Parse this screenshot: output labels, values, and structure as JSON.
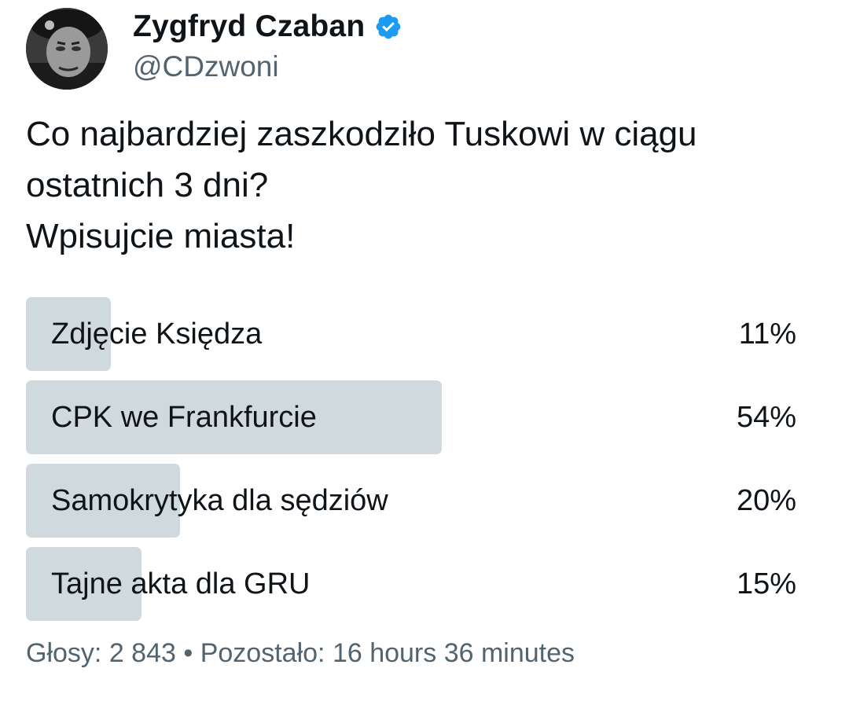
{
  "author": {
    "display_name": "Zygfryd Czaban",
    "handle": "@CDzwoni",
    "verified": true,
    "verified_color": "#1d9bf0"
  },
  "tweet": {
    "lines": [
      "Co najbardziej zaszkodziło Tuskowi w ciągu",
      "ostatnich 3 dni?",
      "Wpisujcie miasta!"
    ]
  },
  "poll": {
    "bar_color": "#cfd9de",
    "options": [
      {
        "label": "Zdjęcie Księdza",
        "percent_text": "11%",
        "fraction": 0.11
      },
      {
        "label": "CPK we Frankfurcie",
        "percent_text": "54%",
        "fraction": 0.54
      },
      {
        "label": "Samokrytyka dla sędziów",
        "percent_text": "20%",
        "fraction": 0.2
      },
      {
        "label": "Tajne akta dla GRU",
        "percent_text": "15%",
        "fraction": 0.15
      }
    ],
    "votes_label": "Głosy:",
    "votes_count": "2 843",
    "separator": "•",
    "remaining_label": "Pozostało:",
    "remaining_time": "16 hours 36 minutes"
  }
}
